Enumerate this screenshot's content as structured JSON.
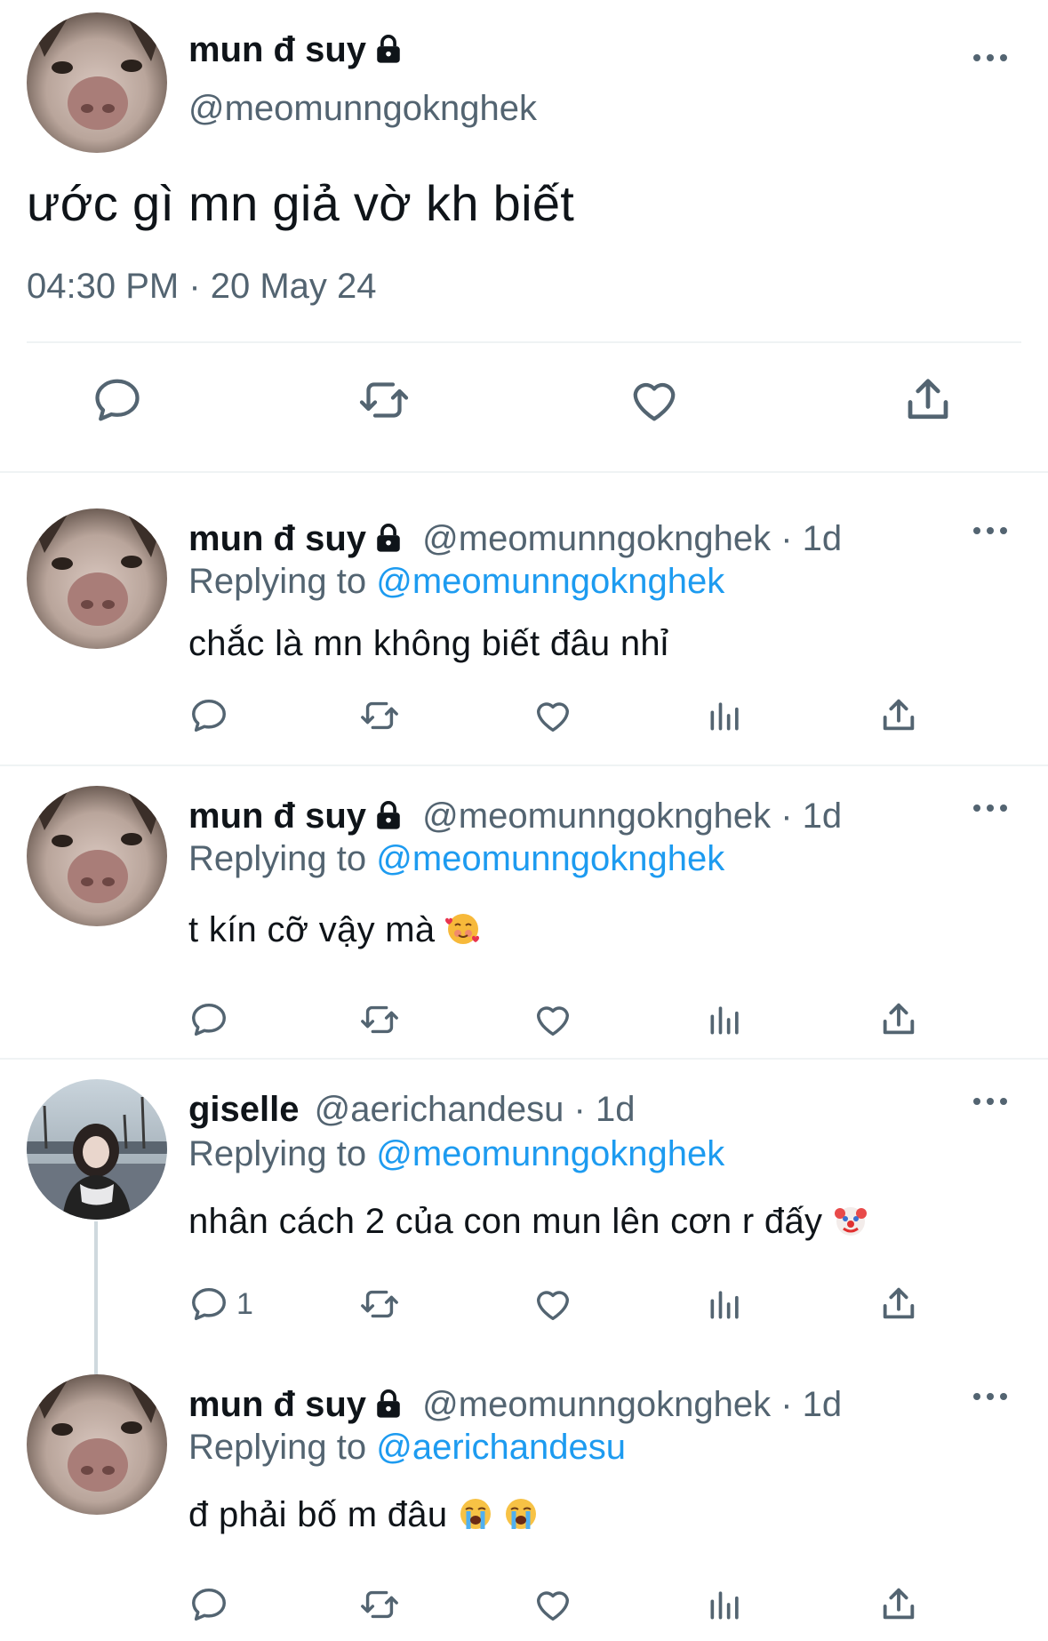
{
  "main_tweet": {
    "author_name": "mun đ suy",
    "author_handle": "@meomunngoknghek",
    "text": "ước gì mn giả vờ kh biết",
    "timestamp": "04:30 PM · 20 May 24",
    "icons": [
      "reply-icon",
      "retweet-icon",
      "like-icon",
      "share-icon"
    ]
  },
  "replies": [
    {
      "author_name": "mun đ suy",
      "author_handle": "@meomunngoknghek",
      "time": "· 1d",
      "replying_label": "Replying to",
      "replying_to": "@meomunngoknghek",
      "text": "chắc là mn không biết đâu nhỉ",
      "emojis": [],
      "reply_count": ""
    },
    {
      "author_name": "mun đ suy",
      "author_handle": "@meomunngoknghek",
      "time": "· 1d",
      "replying_label": "Replying to",
      "replying_to": "@meomunngoknghek",
      "text": "t kín cỡ vậy mà",
      "emojis": [
        "smiling-face-with-hearts"
      ],
      "reply_count": ""
    },
    {
      "author_name": "giselle",
      "author_handle": "@aerichandesu",
      "time": "· 1d",
      "replying_label": "Replying to",
      "replying_to": "@meomunngoknghek",
      "text": "nhân cách 2 của con mun lên cơn r đấy",
      "emojis": [
        "clown-face"
      ],
      "reply_count": "1"
    },
    {
      "author_name": "mun đ suy",
      "author_handle": "@meomunngoknghek",
      "time": "· 1d",
      "replying_label": "Replying to",
      "replying_to": "@aerichandesu",
      "text": "đ phải bố m đâu",
      "emojis": [
        "loudly-crying-face",
        "loudly-crying-face"
      ],
      "reply_count": ""
    }
  ],
  "colors": {
    "text": "#0f1419",
    "muted": "#536471",
    "link": "#1d9bf0",
    "divider": "#eff3f4",
    "thread_line": "#cfd9de"
  }
}
